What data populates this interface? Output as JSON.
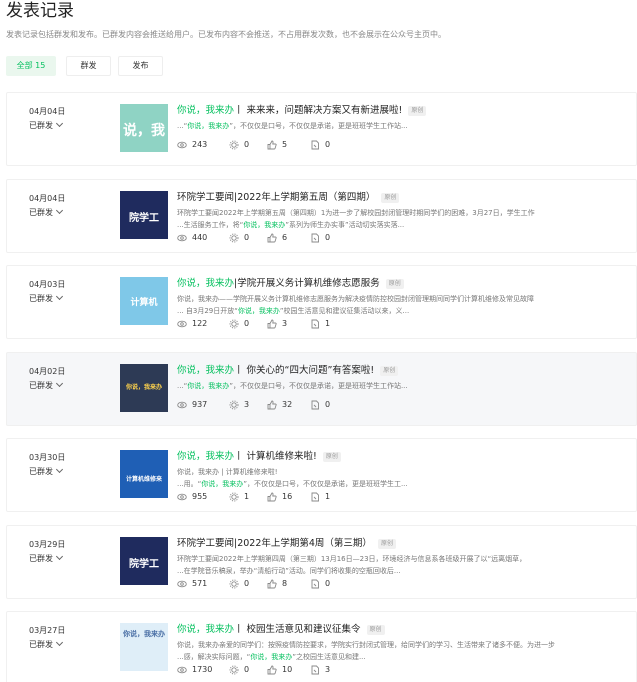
{
  "header": {
    "title": "发表记录",
    "description": "发表记录包括群发和发布。已群发内容会推送给用户。已发布内容不会推送，不占用群发次数，也不会展示在公众号主页中。"
  },
  "filters": {
    "all_label": "全部",
    "all_count": "15",
    "mass_label": "群发",
    "publish_label": "发布"
  },
  "colors": {
    "accent": "#07c160",
    "accent_bg": "#eaf7ee"
  },
  "posts": [
    {
      "date": "04月04日",
      "status": "已群发",
      "title_green": "你说，我来办",
      "title_rest": "丨 来来来，问题解决方案又有新进展啦!",
      "tag": "原创",
      "line1_pre": "...“",
      "line1_green": "你说，我来办",
      "line1_post": "”，不仅仅是口号，不仅仅是承诺，更是班班学生工作站...",
      "line2": "",
      "thumb_text": "说，我",
      "reads": "243",
      "shares": "0",
      "likes": "5",
      "wows": "0"
    },
    {
      "date": "04月04日",
      "status": "已群发",
      "title_green": "",
      "title_rest": "环院学工要闻|2022年上学期第五周（第四期）",
      "tag": "原创",
      "line1_pre": "环院学工要闻2022年上学期第五周（第四期）1为进一步了解校园封闭管理时期同学们的困难，3月27日，学生工作",
      "line1_green": "",
      "line1_post": "",
      "line2_pre": "...生活服务工作，将“",
      "line2_green": "你说，我来办",
      "line2_post": "”系列为师生办实事”活动切实落实落...",
      "thumb_text": "院学工",
      "reads": "440",
      "shares": "0",
      "likes": "6",
      "wows": "0"
    },
    {
      "date": "04月03日",
      "status": "已群发",
      "title_green": "你说，我来办",
      "title_rest": "|学院开展义务计算机维修志愿服务",
      "tag": "原创",
      "line1_pre": "你说，我来办——学院开展义务计算机维修志愿服务为解决疫情防控校园封闭管理期间同学们计算机维修及常见故障",
      "line1_green": "",
      "line1_post": "",
      "line2_pre": "... 自3月29日开放“",
      "line2_green": "你说，我来办",
      "line2_post": "”校园生活意见和建议征集活动以来，义...",
      "thumb_text": "计算机",
      "reads": "122",
      "shares": "0",
      "likes": "3",
      "wows": "1"
    },
    {
      "date": "04月02日",
      "status": "已群发",
      "title_green": "你说，我来办",
      "title_rest": "丨 你关心的“四大问题”有答案啦!",
      "tag": "原创",
      "line1_pre": "...“",
      "line1_green": "你说，我来办",
      "line1_post": "”，不仅仅是口号，不仅仅是承诺，更是班班学生工作站...",
      "line2": "",
      "thumb_text": "你说，我来办",
      "reads": "937",
      "shares": "3",
      "likes": "32",
      "wows": "0"
    },
    {
      "date": "03月30日",
      "status": "已群发",
      "title_green": "你说，我来办",
      "title_rest": "丨 计算机维修来啦!",
      "tag": "原创",
      "line1_pre": "你说，我来办 | 计算机维修来啦!",
      "line1_green": "",
      "line1_post": "",
      "line2_pre": "...用。“",
      "line2_green": "你说，我来办",
      "line2_post": "”，不仅仅是口号，不仅仅是承诺，更是班班学生工...",
      "thumb_text": "计算机维修来",
      "reads": "955",
      "shares": "1",
      "likes": "16",
      "wows": "1"
    },
    {
      "date": "03月29日",
      "status": "已群发",
      "title_green": "",
      "title_rest": "环院学工要闻|2022年上学期第4周（第三期）",
      "tag": "原创",
      "line1_pre": "环院学工要闻2022年上学期第四周（第三期）13月16日—23日，环境经济与信息系各班级开展了以“远离烟草，",
      "line1_green": "",
      "line1_post": "",
      "line2_pre": "...在学院音乐稿泉，举办“清船行动”活动。同学们将收集的空瓶回收后...",
      "line2_green": "",
      "line2_post": "",
      "thumb_text": "院学工",
      "reads": "571",
      "shares": "0",
      "likes": "8",
      "wows": "0"
    },
    {
      "date": "03月27日",
      "status": "已群发",
      "title_green": "你说，我来办",
      "title_rest": "丨 校园生活意见和建议征集令",
      "tag": "原创",
      "line1_pre": "你说，我来办亲爱的同学们：按照疫情防控要求，学院实行封闭式管理，给同学们的学习、生活带来了诸多不便。为进一步",
      "line1_green": "",
      "line1_post": "",
      "line2_pre": "...感，解决实际问题，“",
      "line2_green": "你说，我来办",
      "line2_post": "”之校园生活意见和建...",
      "thumb_text": "你说，我来办",
      "reads": "1730",
      "shares": "0",
      "likes": "10",
      "wows": "3"
    }
  ]
}
